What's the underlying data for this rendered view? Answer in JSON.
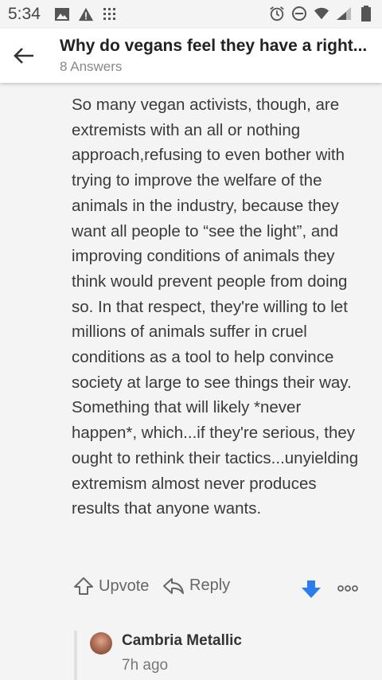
{
  "status_bar": {
    "time": "5:34",
    "left_icons": [
      "image-icon",
      "warning-icon",
      "grid-icon"
    ],
    "right_icons": [
      "alarm-icon",
      "dnd-icon",
      "wifi-icon",
      "signal-icon",
      "battery-icon"
    ]
  },
  "header": {
    "title": "Why do vegans feel they have a right...",
    "subtitle": "8 Answers"
  },
  "answer": {
    "text": "So many vegan activists, though, are extremists with an all or nothing approach,refusing to even bother with trying to improve the welfare of the animals in the industry, because they want all people to “see the light”, and improving conditions of animals they think would prevent people from doing so. In that respect, they're willing to let millions of animals suffer in cruel conditions as a tool to help convince society at large to see things their way. Something that will likely *never happen*, which...if they're serious, they ought to rethink their tactics...unyielding extremism almost never produces results that anyone wants."
  },
  "actions": {
    "upvote_label": "Upvote",
    "reply_label": "Reply",
    "downvote_color": "#2b7de9"
  },
  "comment": {
    "author": "Cambria Metallic",
    "time": "7h ago"
  }
}
